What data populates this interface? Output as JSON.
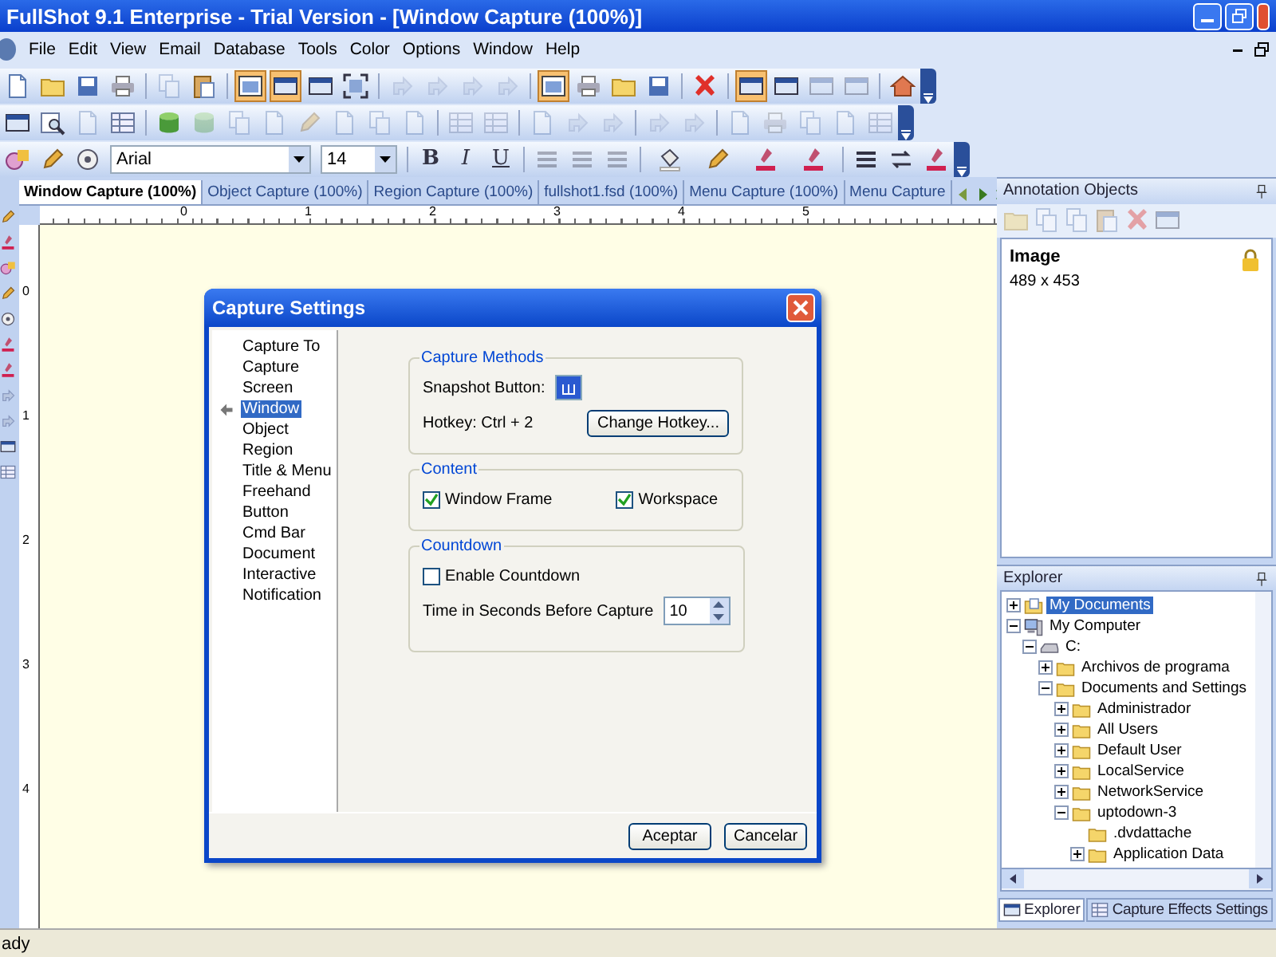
{
  "window": {
    "title": "FullShot 9.1 Enterprise - Trial Version - [Window Capture (100%)]"
  },
  "menu": [
    "File",
    "Edit",
    "View",
    "Email",
    "Database",
    "Tools",
    "Color",
    "Options",
    "Window",
    "Help"
  ],
  "toolbars": [
    {
      "buttons": [
        {
          "pressed": false,
          "disabled": false
        },
        {
          "pressed": false,
          "disabled": false
        },
        {
          "pressed": false,
          "disabled": false
        },
        {
          "pressed": false,
          "disabled": false
        },
        {
          "pressed": false,
          "disabled": true
        },
        {
          "pressed": false,
          "disabled": false
        },
        {
          "pressed": true,
          "disabled": false
        },
        {
          "pressed": true,
          "disabled": false
        },
        {
          "pressed": false,
          "disabled": false
        },
        {
          "pressed": false,
          "disabled": false
        },
        {
          "pressed": false,
          "disabled": true
        },
        {
          "pressed": false,
          "disabled": true
        },
        {
          "pressed": false,
          "disabled": true
        },
        {
          "pressed": false,
          "disabled": true
        },
        {
          "pressed": true,
          "disabled": false
        },
        {
          "pressed": false,
          "disabled": false
        },
        {
          "pressed": false,
          "disabled": false
        },
        {
          "pressed": false,
          "disabled": false
        },
        {
          "pressed": false,
          "disabled": false
        },
        {
          "pressed": true,
          "disabled": false
        },
        {
          "pressed": false,
          "disabled": false
        },
        {
          "pressed": false,
          "disabled": true
        },
        {
          "pressed": false,
          "disabled": true
        },
        {
          "pressed": false,
          "disabled": false
        }
      ]
    },
    {
      "buttons": [
        {
          "pressed": false,
          "disabled": false
        },
        {
          "pressed": false,
          "disabled": false
        },
        {
          "pressed": false,
          "disabled": true
        },
        {
          "pressed": false,
          "disabled": false
        },
        {
          "pressed": false,
          "disabled": false
        },
        {
          "pressed": false,
          "disabled": true
        },
        {
          "pressed": false,
          "disabled": true
        },
        {
          "pressed": false,
          "disabled": true
        },
        {
          "pressed": false,
          "disabled": true
        },
        {
          "pressed": false,
          "disabled": true
        },
        {
          "pressed": false,
          "disabled": true
        },
        {
          "pressed": false,
          "disabled": true
        },
        {
          "pressed": false,
          "disabled": true
        },
        {
          "pressed": false,
          "disabled": true
        },
        {
          "pressed": false,
          "disabled": true
        },
        {
          "pressed": false,
          "disabled": true
        },
        {
          "pressed": false,
          "disabled": true
        },
        {
          "pressed": false,
          "disabled": true
        },
        {
          "pressed": false,
          "disabled": true
        },
        {
          "pressed": false,
          "disabled": true
        },
        {
          "pressed": false,
          "disabled": true
        },
        {
          "pressed": false,
          "disabled": true
        },
        {
          "pressed": false,
          "disabled": true
        },
        {
          "pressed": false,
          "disabled": true
        }
      ]
    }
  ],
  "format_bar": {
    "font": "Arial",
    "size": "14",
    "styles": [
      "B",
      "I",
      "U"
    ]
  },
  "doc_tabs": [
    {
      "label": "Window Capture (100%)",
      "selected": true
    },
    {
      "label": "Object Capture (100%)",
      "selected": false
    },
    {
      "label": "Region Capture (100%)",
      "selected": false
    },
    {
      "label": "fullshot1.fsd (100%)",
      "selected": false
    },
    {
      "label": "Menu Capture (100%)",
      "selected": false
    },
    {
      "label": "Menu Capture",
      "selected": false
    }
  ],
  "ruler": {
    "horizontal": [
      "0",
      "1",
      "2",
      "3",
      "4",
      "5"
    ],
    "vertical": [
      "0",
      "1",
      "2",
      "3",
      "4"
    ]
  },
  "dialog": {
    "title": "Capture Settings",
    "categories": [
      {
        "label": "Capture To",
        "selected": false
      },
      {
        "label": "Capture",
        "selected": false
      },
      {
        "label": "Screen",
        "selected": false
      },
      {
        "label": "Window",
        "selected": true
      },
      {
        "label": "Object",
        "selected": false
      },
      {
        "label": "Region",
        "selected": false
      },
      {
        "label": "Title & Menu",
        "selected": false
      },
      {
        "label": "Freehand",
        "selected": false
      },
      {
        "label": "Button",
        "selected": false
      },
      {
        "label": "Cmd Bar",
        "selected": false
      },
      {
        "label": "Document",
        "selected": false
      },
      {
        "label": "Interactive",
        "selected": false
      },
      {
        "label": "Notification",
        "selected": false
      }
    ],
    "capture_methods": {
      "title": "Capture Methods",
      "snapshot_label": "Snapshot Button:",
      "hotkey": "Hotkey: Ctrl + 2",
      "change_button": "Change Hotkey..."
    },
    "content": {
      "title": "Content",
      "options": [
        {
          "label": "Window Frame",
          "checked": true
        },
        {
          "label": "Workspace",
          "checked": true
        }
      ]
    },
    "countdown": {
      "title": "Countdown",
      "enable": {
        "label": "Enable Countdown",
        "checked": false
      },
      "seconds_label": "Time in Seconds Before Capture",
      "seconds": "10"
    },
    "buttons": [
      "Aceptar",
      "Cancelar"
    ]
  },
  "annotation_panel": {
    "title": "Annotation Objects",
    "item": {
      "name": "Image",
      "size": "489 x 453"
    }
  },
  "explorer": {
    "title": "Explorer",
    "tree": [
      {
        "label": "My Documents",
        "kind": "documents",
        "expanded": false,
        "selected": true
      },
      {
        "label": "My Computer",
        "kind": "computer",
        "expanded": true,
        "selected": false,
        "children": [
          {
            "label": "C:",
            "kind": "drive",
            "expanded": true,
            "selected": false,
            "children": [
              {
                "label": "Archivos de programa",
                "kind": "folder",
                "expanded": false,
                "selected": false
              },
              {
                "label": "Documents and Settings",
                "kind": "folder",
                "expanded": true,
                "selected": false,
                "children": [
                  {
                    "label": "Administrador",
                    "kind": "folder",
                    "expanded": false,
                    "selected": false
                  },
                  {
                    "label": "All Users",
                    "kind": "folder",
                    "expanded": false,
                    "selected": false
                  },
                  {
                    "label": "Default User",
                    "kind": "folder",
                    "expanded": false,
                    "selected": false
                  },
                  {
                    "label": "LocalService",
                    "kind": "folder",
                    "expanded": false,
                    "selected": false
                  },
                  {
                    "label": "NetworkService",
                    "kind": "folder",
                    "expanded": false,
                    "selected": false
                  },
                  {
                    "label": "uptodown-3",
                    "kind": "folder",
                    "expanded": true,
                    "selected": false,
                    "children": [
                      {
                        "label": ".dvdattache",
                        "kind": "folder",
                        "selected": false
                      },
                      {
                        "label": "Application Data",
                        "kind": "folder",
                        "expanded": false,
                        "selected": false
                      }
                    ]
                  }
                ]
              }
            ]
          }
        ]
      }
    ],
    "tabs": [
      {
        "label": "Explorer",
        "selected": true
      },
      {
        "label": "Capture Effects Settings",
        "selected": false
      }
    ]
  },
  "status_bar": {
    "text": "ady"
  }
}
